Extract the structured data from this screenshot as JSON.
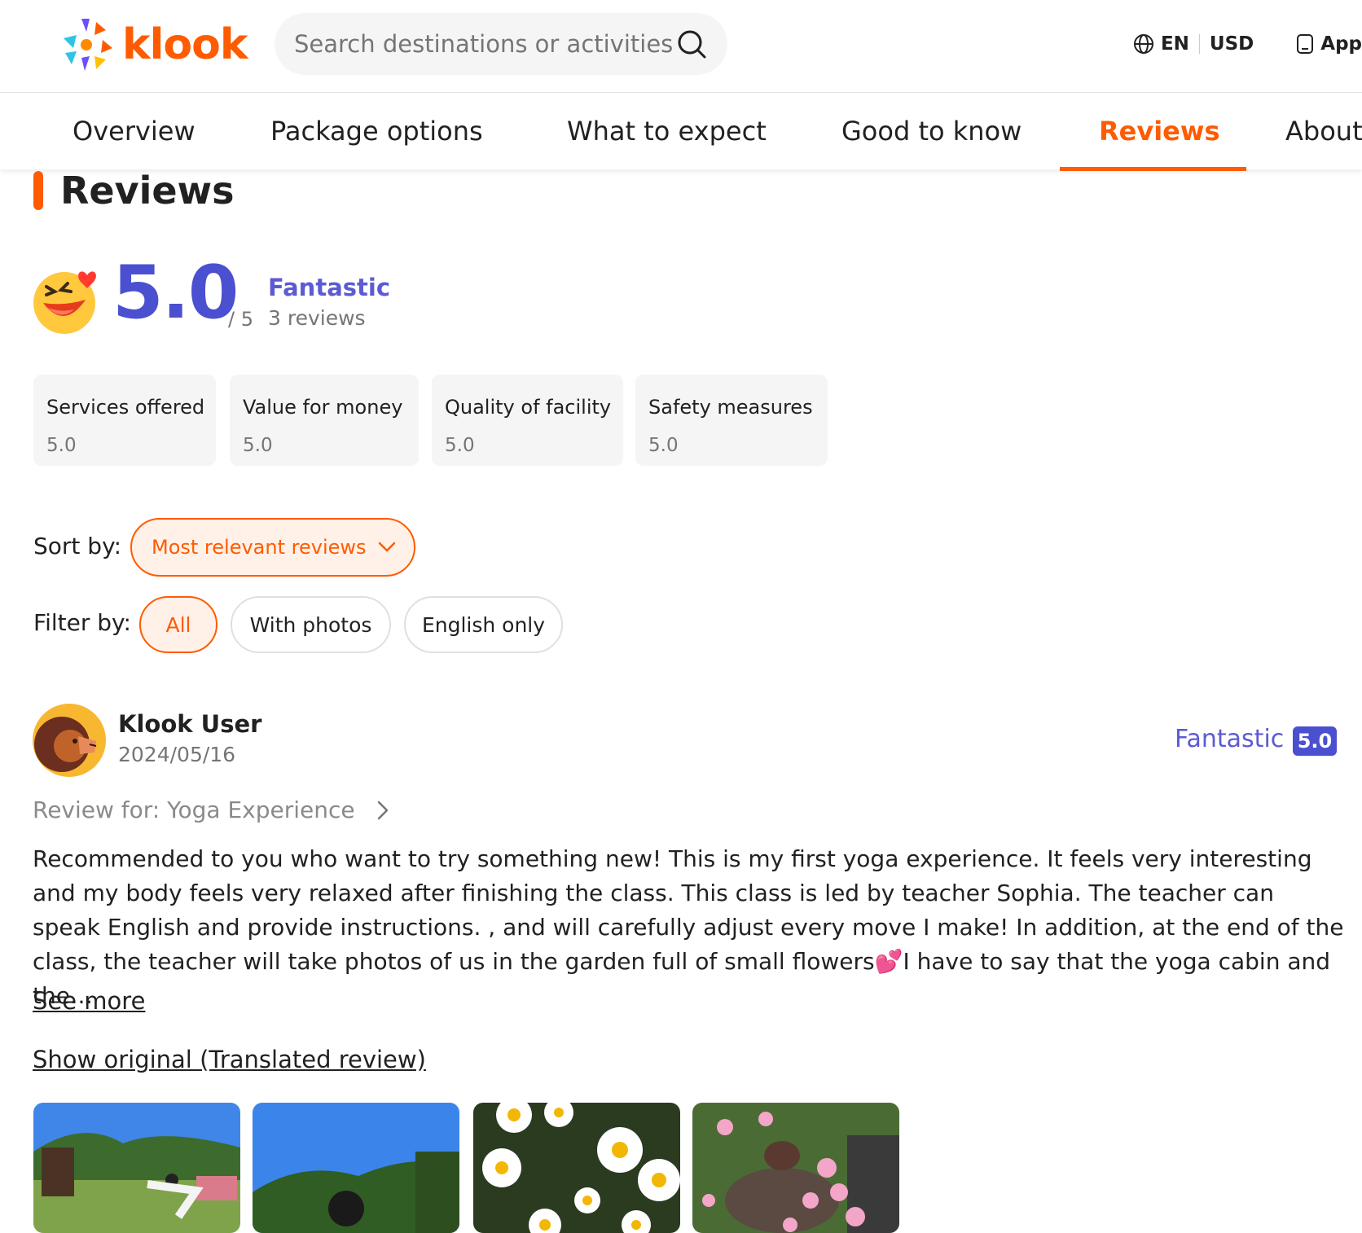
{
  "header": {
    "brand": "klook",
    "search_placeholder": "Search destinations or activities",
    "language": "EN",
    "currency": "USD",
    "app_label": "App"
  },
  "tabs": [
    {
      "label": "Overview",
      "active": false
    },
    {
      "label": "Package options",
      "active": false
    },
    {
      "label": "What to expect",
      "active": false
    },
    {
      "label": "Good to know",
      "active": false
    },
    {
      "label": "Reviews",
      "active": true
    },
    {
      "label": "About",
      "active": false
    }
  ],
  "reviews_section": {
    "title": "Reviews",
    "score": "5.0",
    "score_out_of": "/ 5",
    "score_label": "Fantastic",
    "review_count": "3 reviews",
    "sub_ratings": [
      {
        "name": "Services offered",
        "value": "5.0"
      },
      {
        "name": "Value for money",
        "value": "5.0"
      },
      {
        "name": "Quality of facility",
        "value": "5.0"
      },
      {
        "name": "Safety measures",
        "value": "5.0"
      }
    ],
    "sort_label": "Sort by:",
    "sort_value": "Most relevant reviews",
    "filter_label": "Filter by:",
    "filters": [
      {
        "label": "All",
        "active": true
      },
      {
        "label": "With photos",
        "active": false
      },
      {
        "label": "English only",
        "active": false
      }
    ]
  },
  "review": {
    "user": "Klook User",
    "date": "2024/05/16",
    "rating_label": "Fantastic",
    "rating": "5.0",
    "review_for": "Review for: Yoga Experience",
    "text": "Recommended to you who want to try something new! This is my first yoga experience. It feels very interesting and my body feels very relaxed after finishing the class. This class is led by teacher Sophia. The teacher can speak English and provide instructions. , and will carefully adjust every move I make! In addition, at the end of the class, the teacher will take photos of us in the garden full of small flowers💕I have to say that the yoga cabin and the…",
    "see_more": "See more",
    "show_original": "Show original (Translated review)",
    "photos": [
      "yoga-pose-photo",
      "yoga-stretch-photo",
      "daisy-flowers-photo",
      "pink-flowers-photo"
    ]
  },
  "colors": {
    "brand_orange": "#ff5b00",
    "rating_purple": "#4b50d0"
  }
}
